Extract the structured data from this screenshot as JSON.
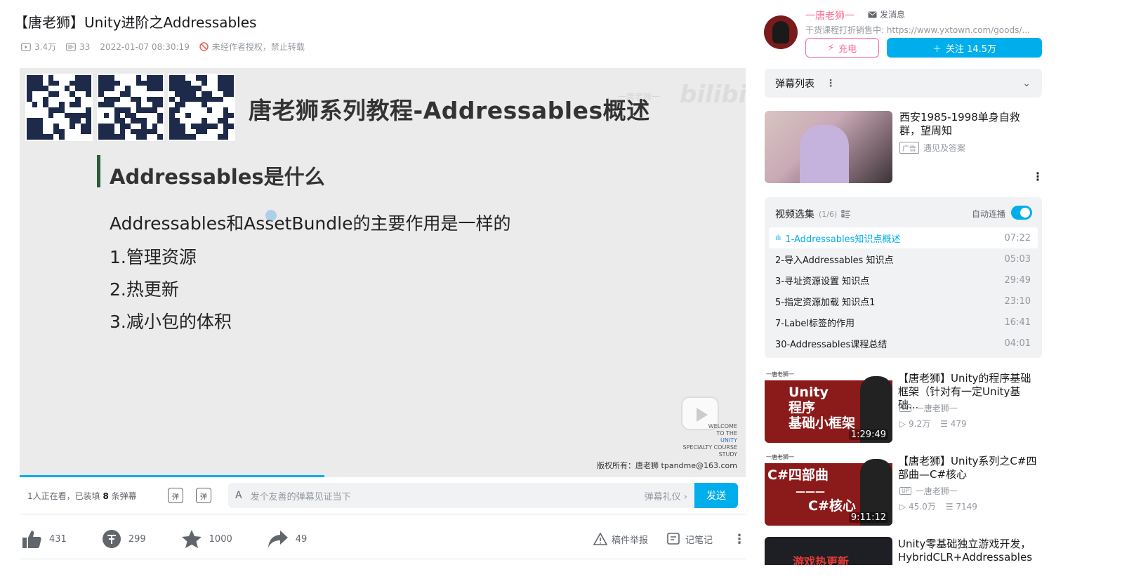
{
  "video": {
    "title": "【唐老狮】Unity进阶之Addressables",
    "views": "3.4万",
    "danmaku_count": "33",
    "date": "2022-01-07 08:30:19",
    "copyright_notice": "未经作者授权，禁止转载"
  },
  "slide": {
    "title": "唐老狮系列教程-Addressables概述",
    "watermark": "bilibili",
    "heading": "Addressables是什么",
    "bullets": [
      "Addressables和AssetBundle的主要作用是一样的",
      "1.管理资源",
      "2.热更新",
      "3.减小包的体积"
    ],
    "welcome_lines": [
      "WELCOME",
      "TO THE",
      "UNITY",
      "SPECIALTY COURSE",
      "STUDY"
    ],
    "copyright": "版权所有：唐老狮 tpandme@163.com"
  },
  "player": {
    "progress_percent": 42,
    "viewing_prefix": "1人正在看，已装填 ",
    "viewing_count": "8",
    "viewing_suffix": " 条弹幕",
    "danmaku_toggle_label": "弹",
    "danmaku_settings_label": "弹",
    "input_icon": "A",
    "input_placeholder": "发个友善的弹幕见证当下",
    "etiquette": "弹幕礼仪 ›",
    "send_label": "发送"
  },
  "actions": {
    "like": "431",
    "coin": "299",
    "favorite": "1000",
    "share": "49",
    "report": "稿件举报",
    "notes": "记笔记"
  },
  "uploader": {
    "name": "一唐老狮一",
    "message": "发消息",
    "description": "干货课程打折销售中: https://www.yxtown.com/goods/...",
    "charge": "充电",
    "follow": "关注 14.5万"
  },
  "danmaku_list": {
    "title": "弹幕列表"
  },
  "ad": {
    "title": "西安1985-1998单身自救群，望周知",
    "tag": "广告",
    "source": "遇见及答案"
  },
  "playlist": {
    "title": "视频选集",
    "count": "(1/6)",
    "autoplay": "自动连播",
    "episodes": [
      {
        "name": "1-Addressables知识点概述",
        "duration": "07:22"
      },
      {
        "name": "2-导入Addressables 知识点",
        "duration": "05:03"
      },
      {
        "name": "3-寻址资源设置 知识点",
        "duration": "29:49"
      },
      {
        "name": "5-指定资源加载 知识点1",
        "duration": "23:10"
      },
      {
        "name": "7-Label标签的作用",
        "duration": "16:41"
      },
      {
        "name": "30-Addressables课程总结",
        "duration": "04:01"
      }
    ]
  },
  "recommendations": [
    {
      "title": "【唐老狮】Unity的程序基础框架（针对有一定Unity基础...",
      "thumb_top": "一唐老狮一",
      "thumb_text": [
        "Unity",
        "程序",
        "基础小框架"
      ],
      "duration": "1:29:49",
      "up_tag": "UP",
      "up": "一唐老狮一",
      "views": "9.2万",
      "danmaku": "479"
    },
    {
      "title": "【唐老狮】Unity系列之C#四部曲—C#核心",
      "thumb_top": "一唐老狮一",
      "thumb_text": [
        "C#四部曲",
        "———",
        "C#核心"
      ],
      "duration": "9:11:12",
      "up_tag": "UP",
      "up": "一唐老狮一",
      "views": "45.0万",
      "danmaku": "7149"
    },
    {
      "title": "Unity零基础独立游戏开发，HybridCLR+Addressables热...",
      "thumb_text": [
        "游戏热更新"
      ]
    }
  ],
  "colors": {
    "accent": "#00aeec",
    "pink": "#ff6699",
    "text": "#18191c",
    "muted": "#9499a0"
  }
}
